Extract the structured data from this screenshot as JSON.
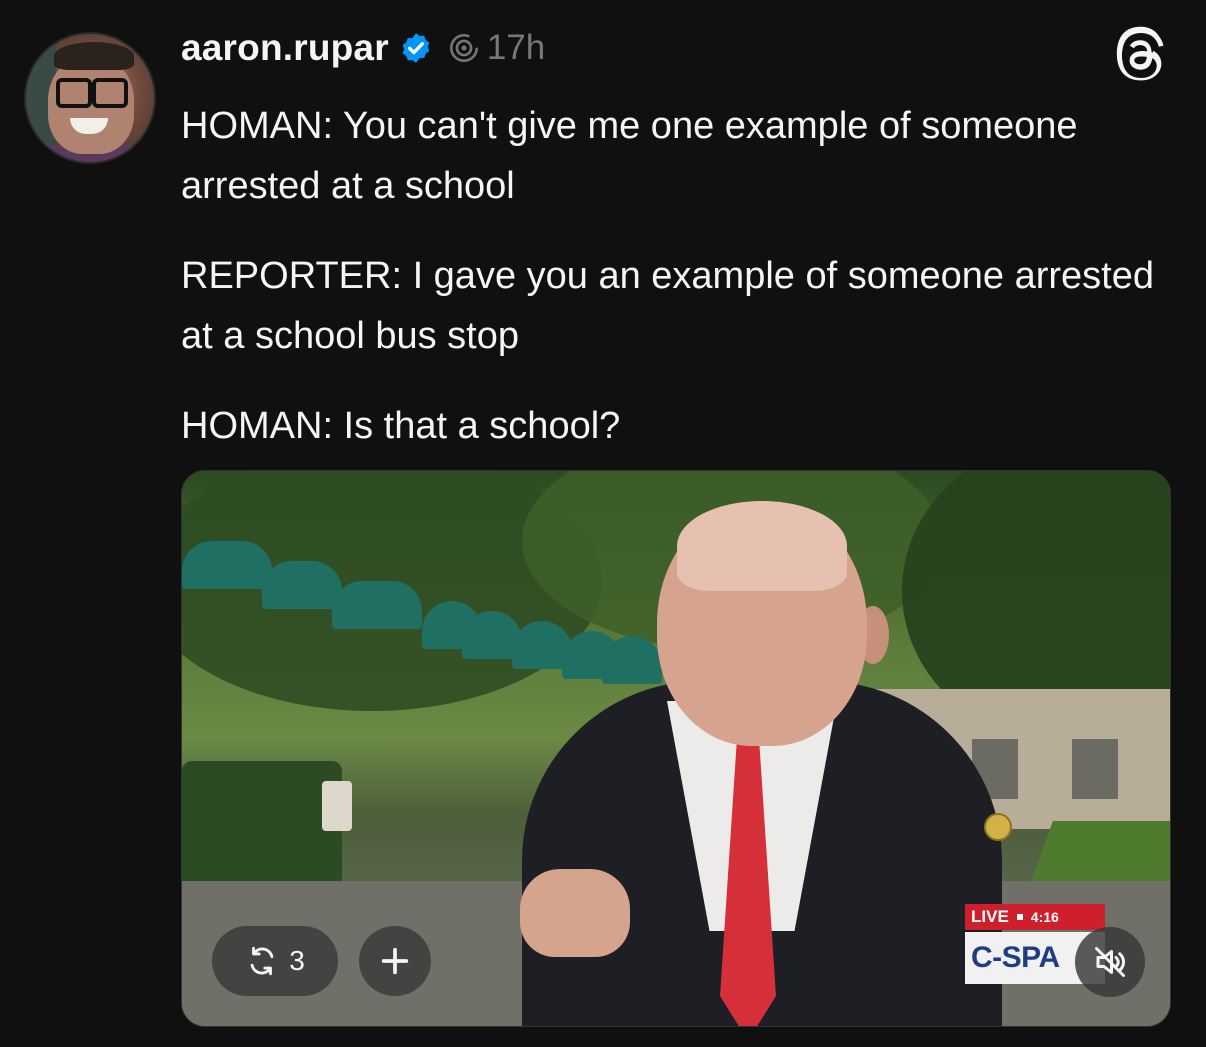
{
  "post": {
    "author": {
      "username": "aaron.rupar",
      "verified": true,
      "avatar_icon": "avatar"
    },
    "timestamp": "17h",
    "icons": {
      "verified": "verified-badge-icon",
      "activity": "threads-activity-icon",
      "app_logo": "threads-logo-icon"
    },
    "text": [
      "HOMAN: You can't give me one example of someone arrested at a school",
      "REPORTER: I gave you an example of someone arrested at a school bus stop",
      "HOMAN: Is that a school?"
    ],
    "video": {
      "broadcast_badge": {
        "live": "LIVE",
        "time": "4:16",
        "network": "C-SPA"
      },
      "repost_count": "3",
      "controls": {
        "repost_icon": "repost-icon",
        "add_icon": "plus-icon",
        "mute_icon": "mute-icon"
      }
    },
    "colors": {
      "background": "#101010",
      "text": "#f3f5f7",
      "muted": "#777777",
      "verified_blue": "#0095f6",
      "live_red": "#cf1f2c",
      "tie_red": "#d5303a"
    }
  }
}
